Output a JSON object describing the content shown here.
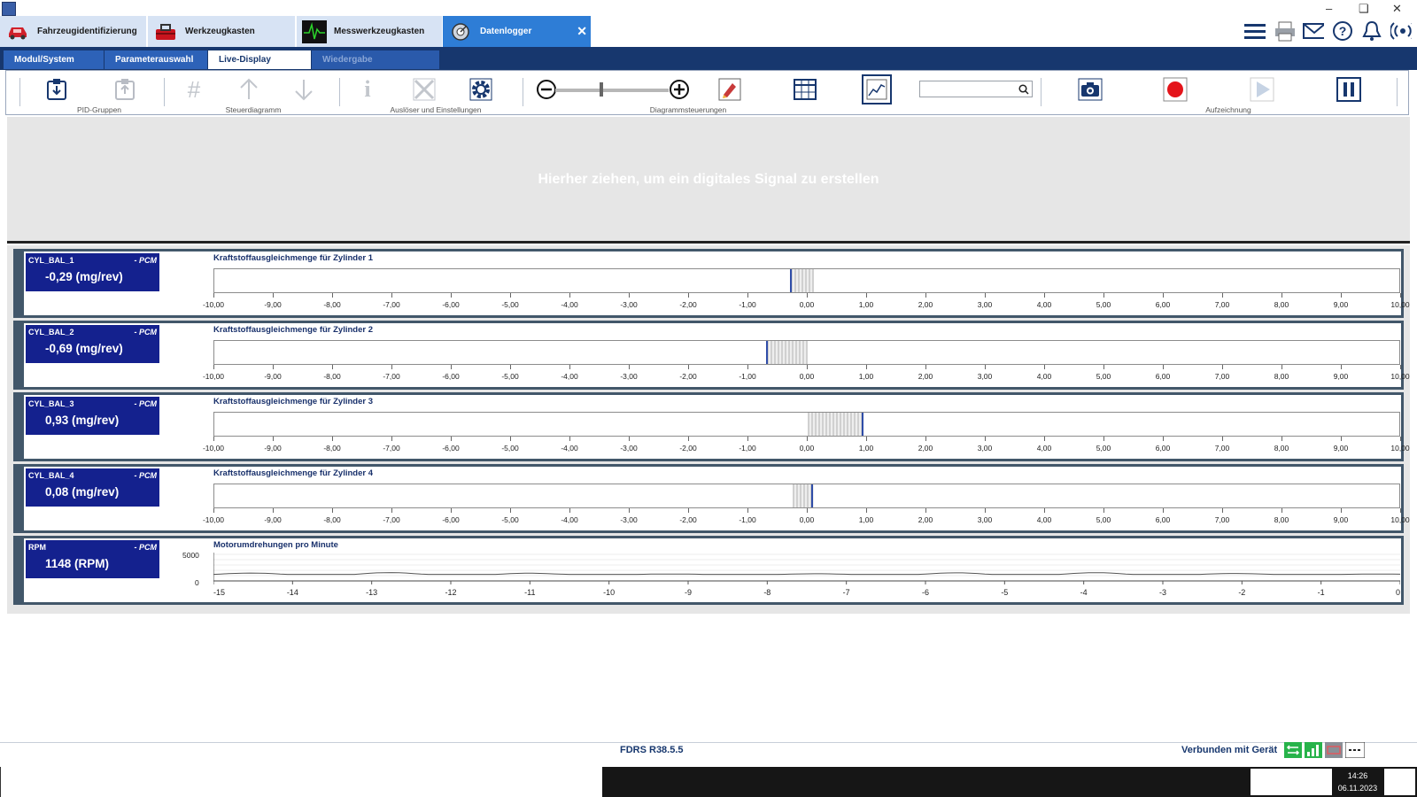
{
  "app_tabs": [
    {
      "label": "Fahrzeugidentifizierung",
      "icon": "car-icon"
    },
    {
      "label": "Werkzeugkasten",
      "icon": "toolbox-icon"
    },
    {
      "label": "Messwerkzeugkasten",
      "icon": "oscilloscope-icon"
    },
    {
      "label": "Datenlogger",
      "icon": "datalogger-icon",
      "active": true
    }
  ],
  "sub_tabs": [
    {
      "label": "Modul/System"
    },
    {
      "label": "Parameterauswahl"
    },
    {
      "label": "Live-Display",
      "active": true
    },
    {
      "label": "Wiedergabe",
      "disabled": true
    }
  ],
  "toolbar_groups": {
    "pid": "PID-Gruppen",
    "control": "Steuerdiagramm",
    "trigger": "Auslöser und Einstellungen",
    "chart": "Diagrammsteuerungen",
    "record": "Aufzeichnung"
  },
  "dropzone_text": "Hierher ziehen, um ein digitales Signal zu erstellen",
  "scale_labels": [
    "-10,00",
    "-9,00",
    "-8,00",
    "-7,00",
    "-6,00",
    "-5,00",
    "-4,00",
    "-3,00",
    "-2,00",
    "-1,00",
    "0,00",
    "1,00",
    "2,00",
    "3,00",
    "4,00",
    "5,00",
    "6,00",
    "7,00",
    "8,00",
    "9,00",
    "10,00"
  ],
  "params": [
    {
      "name": "CYL_BAL_1",
      "module": "- PCM",
      "value_text": "-0,29 (mg/rev)",
      "title": "Kraftstoffausgleichmenge für Zylinder 1",
      "value": -0.29,
      "range": [
        -0.29,
        0.1
      ]
    },
    {
      "name": "CYL_BAL_2",
      "module": "- PCM",
      "value_text": "-0,69 (mg/rev)",
      "title": "Kraftstoffausgleichmenge für Zylinder 2",
      "value": -0.69,
      "range": [
        -0.69,
        0.0
      ]
    },
    {
      "name": "CYL_BAL_3",
      "module": "- PCM",
      "value_text": "0,93 (mg/rev)",
      "title": "Kraftstoffausgleichmenge für Zylinder 3",
      "value": 0.93,
      "range": [
        0.0,
        0.93
      ]
    },
    {
      "name": "CYL_BAL_4",
      "module": "- PCM",
      "value_text": "0,08 (mg/rev)",
      "title": "Kraftstoffausgleichmenge für Zylinder 4",
      "value": 0.08,
      "range": [
        -0.25,
        0.1
      ]
    }
  ],
  "rpm": {
    "name": "RPM",
    "module": "- PCM",
    "value_text": "1148 (RPM)",
    "title": "Motorumdrehungen pro Minute",
    "y_labels": [
      "5000",
      "0"
    ],
    "x_labels": [
      "-15",
      "-14",
      "-13",
      "-12",
      "-11",
      "-10",
      "-9",
      "-8",
      "-7",
      "-6",
      "-5",
      "-4",
      "-3",
      "-2",
      "-1",
      "0"
    ]
  },
  "status": {
    "version": "FDRS R38.5.5",
    "connected": "Verbunden mit Gerät"
  },
  "clock": {
    "time": "14:26",
    "date": "06.11.2023"
  }
}
